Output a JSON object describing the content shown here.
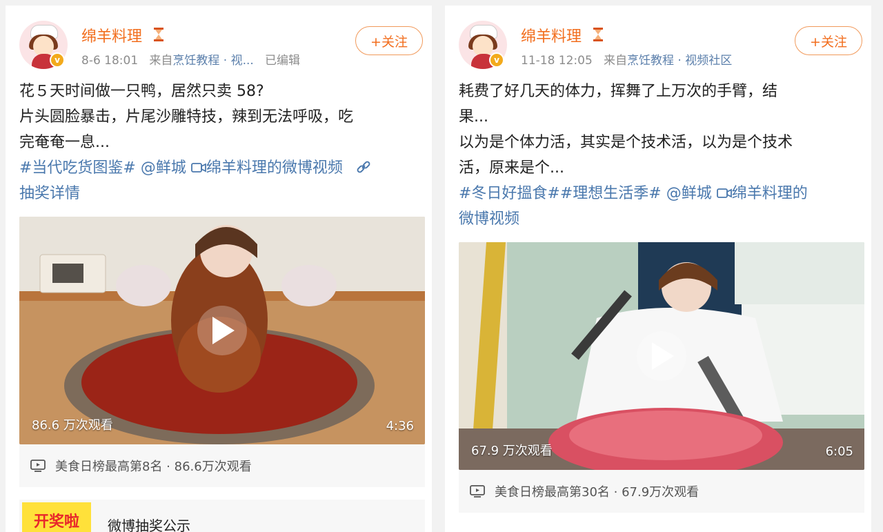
{
  "left": {
    "username": "绵羊料理",
    "follow_label": "+关注",
    "meta_time": "8-6 18:01",
    "meta_from": "来自",
    "meta_source": "烹饪教程 · 视...",
    "meta_edited": "已编辑",
    "text_line1": "花５天时间做一只鸭，居然只卖 58?",
    "text_line2": "片头圆脸暴击，片尾沙雕特技，辣到无法呼吸，吃",
    "text_line3": "完奄奄一息...",
    "tag_topic": "#当代吃货图鉴#",
    "tag_mention": "@鲜城",
    "tag_video": "绵羊料理的微博视频",
    "lottery_link": "抽奖详情",
    "video_views": "86.6 万次观看",
    "video_duration": "4:36",
    "rank_text": "美食日榜最高第8名 · 86.6万次观看",
    "lottery_badge": "开奖啦",
    "lottery_title": "微博抽奖公示"
  },
  "right": {
    "username": "绵羊料理",
    "follow_label": "+关注",
    "meta_time": "11-18 12:05",
    "meta_from": "来自",
    "meta_source": "烹饪教程 · 视频社区",
    "text_line1": "耗费了好几天的体力，挥舞了上万次的手臂，结",
    "text_line2": "果...",
    "text_line3": "以为是个体力活，其实是个技术活，以为是个技术",
    "text_line4": "活，原来是个...",
    "tag_topic1": "#冬日好搵食#",
    "tag_topic2": "#理想生活季#",
    "tag_mention": "@鲜城",
    "tag_video_part1": "绵羊料理的",
    "tag_video_part2": "微博视频",
    "video_views": "67.9 万次观看",
    "video_duration": "6:05",
    "rank_text": "美食日榜最高第30名 · 67.9万次观看"
  },
  "colors": {
    "username": "#f26e1e",
    "link": "#4a78ad",
    "meta": "#8c8c8c"
  },
  "icons": [
    "hourglass-icon",
    "verified-badge-icon",
    "play-icon",
    "video-camera-icon",
    "link-icon",
    "tv-icon"
  ]
}
